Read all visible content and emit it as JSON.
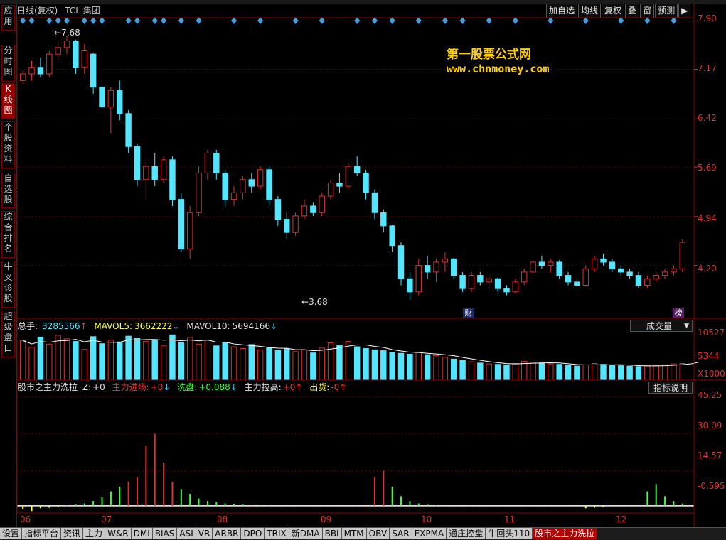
{
  "sidebar": {
    "tabs": [
      {
        "label": "应用",
        "active": false
      },
      {
        "label": "分时图",
        "active": false
      },
      {
        "label": "K线图",
        "active": true
      },
      {
        "label": "个股资料",
        "active": false
      },
      {
        "label": "自选股",
        "active": false
      },
      {
        "label": "综合排名",
        "active": false
      },
      {
        "label": "牛叉诊股",
        "active": false
      },
      {
        "label": "超级盘口",
        "active": false
      }
    ]
  },
  "header": {
    "period": "日线(复权)",
    "stock": "TCL 集团"
  },
  "toolbar": {
    "buttons": [
      "加自选",
      "均线",
      "复权",
      "叠",
      "窗",
      "预测",
      "▶"
    ]
  },
  "watermark": {
    "title": "第一股票公式网",
    "url": "www.chnmoney.com"
  },
  "price_axis": [
    "7.90",
    "7.17",
    "6.42",
    "5.69",
    "4.94",
    "4.20"
  ],
  "annotations": {
    "high": "7.68",
    "low": "3.68",
    "mark1": "财",
    "mark2": "榜"
  },
  "volume": {
    "total_label": "总手:",
    "total_value": "3285566",
    "mavol5_label": "MAVOL5:",
    "mavol5_value": "3662222",
    "mavol10_label": "MAVOL10:",
    "mavol10_value": "5694166",
    "selector": "成交量",
    "axis": [
      "10527",
      "5344",
      "X1000"
    ]
  },
  "indicator": {
    "name": "股市之主力洗拉",
    "z_label": "Z:",
    "z_value": "+0",
    "enter_label": "主力进场:",
    "enter_value": "+0",
    "wash_label": "洗盘:",
    "wash_value": "+0.088",
    "pull_label": "主力拉高:",
    "pull_value": "+0",
    "out_label": "出货:",
    "out_value": "-0",
    "help_button": "指标说明",
    "axis": [
      "45.25",
      "30.09",
      "14.57",
      "-0.595"
    ]
  },
  "x_axis": [
    "06",
    "07",
    "08",
    "09",
    "10",
    "11",
    "12"
  ],
  "bottom_tabs": [
    "设置",
    "指标平台",
    "资讯",
    "主力",
    "W&R",
    "DMI",
    "BIAS",
    "ASI",
    "VR",
    "ARBR",
    "DPO",
    "TRIX",
    "新DMA",
    "BBI",
    "MTM",
    "OBV",
    "SAR",
    "EXPMA",
    "通庄控盘",
    "牛回头110",
    "股市之主力洗拉"
  ],
  "chart_data": {
    "type": "candlestick",
    "ylim": [
      3.4,
      7.95
    ],
    "x": [
      "06",
      "07",
      "08",
      "09",
      "10",
      "11",
      "12"
    ],
    "series": [
      {
        "values": [
          [
            7.0,
            7.15,
            6.95,
            7.1
          ],
          [
            7.1,
            7.3,
            7.0,
            7.2
          ],
          [
            7.2,
            7.35,
            7.05,
            7.1
          ],
          [
            7.1,
            7.45,
            7.05,
            7.4
          ],
          [
            7.4,
            7.6,
            7.3,
            7.5
          ],
          [
            7.5,
            7.68,
            7.4,
            7.6
          ],
          [
            7.6,
            7.62,
            7.1,
            7.2
          ],
          [
            7.2,
            7.55,
            7.1,
            7.45
          ],
          [
            7.4,
            7.42,
            6.8,
            6.9
          ],
          [
            6.9,
            7.0,
            6.5,
            6.6
          ],
          [
            6.6,
            6.9,
            6.2,
            6.85
          ],
          [
            6.85,
            7.0,
            6.4,
            6.5
          ],
          [
            6.5,
            6.55,
            5.9,
            6.0
          ],
          [
            6.0,
            6.05,
            5.4,
            5.5
          ],
          [
            5.5,
            5.8,
            5.2,
            5.7
          ],
          [
            5.7,
            5.9,
            5.4,
            5.5
          ],
          [
            5.5,
            5.85,
            5.45,
            5.8
          ],
          [
            5.8,
            5.85,
            5.1,
            5.2
          ],
          [
            5.2,
            5.3,
            4.4,
            4.45
          ],
          [
            4.45,
            5.1,
            4.3,
            5.0
          ],
          [
            5.0,
            5.7,
            4.95,
            5.6
          ],
          [
            5.6,
            5.95,
            5.5,
            5.9
          ],
          [
            5.9,
            5.95,
            5.5,
            5.6
          ],
          [
            5.6,
            5.65,
            5.1,
            5.2
          ],
          [
            5.2,
            5.4,
            5.1,
            5.3
          ],
          [
            5.3,
            5.55,
            5.2,
            5.5
          ],
          [
            5.5,
            5.6,
            5.3,
            5.4
          ],
          [
            5.4,
            5.7,
            5.35,
            5.65
          ],
          [
            5.65,
            5.7,
            5.1,
            5.2
          ],
          [
            5.2,
            5.25,
            4.8,
            4.9
          ],
          [
            4.9,
            5.0,
            4.6,
            4.7
          ],
          [
            4.7,
            5.0,
            4.65,
            4.95
          ],
          [
            4.95,
            5.2,
            4.9,
            5.1
          ],
          [
            5.1,
            5.15,
            4.95,
            5.0
          ],
          [
            5.0,
            5.3,
            4.95,
            5.25
          ],
          [
            5.25,
            5.5,
            5.2,
            5.45
          ],
          [
            5.45,
            5.6,
            5.3,
            5.4
          ],
          [
            5.4,
            5.75,
            5.35,
            5.7
          ],
          [
            5.7,
            5.85,
            5.55,
            5.6
          ],
          [
            5.6,
            5.65,
            5.2,
            5.3
          ],
          [
            5.3,
            5.35,
            4.9,
            5.0
          ],
          [
            5.0,
            5.05,
            4.7,
            4.8
          ],
          [
            4.8,
            4.82,
            4.4,
            4.5
          ],
          [
            4.5,
            4.55,
            3.9,
            4.0
          ],
          [
            4.0,
            4.1,
            3.68,
            3.8
          ],
          [
            3.8,
            4.3,
            3.75,
            4.2
          ],
          [
            4.2,
            4.35,
            4.0,
            4.1
          ],
          [
            4.1,
            4.3,
            3.95,
            4.25
          ],
          [
            4.25,
            4.4,
            4.1,
            4.3
          ],
          [
            4.3,
            4.32,
            4.0,
            4.05
          ],
          [
            4.05,
            4.1,
            3.8,
            3.85
          ],
          [
            3.85,
            4.1,
            3.8,
            4.05
          ],
          [
            4.05,
            4.1,
            3.9,
            3.95
          ],
          [
            3.95,
            4.05,
            3.85,
            4.0
          ],
          [
            4.0,
            4.02,
            3.8,
            3.85
          ],
          [
            3.85,
            3.9,
            3.75,
            3.8
          ],
          [
            3.8,
            4.0,
            3.78,
            3.95
          ],
          [
            3.95,
            4.15,
            3.9,
            4.1
          ],
          [
            4.1,
            4.3,
            4.05,
            4.25
          ],
          [
            4.25,
            4.35,
            4.15,
            4.2
          ],
          [
            4.2,
            4.3,
            4.1,
            4.25
          ],
          [
            4.25,
            4.28,
            4.0,
            4.05
          ],
          [
            4.05,
            4.1,
            3.9,
            3.95
          ],
          [
            3.95,
            4.0,
            3.85,
            3.9
          ],
          [
            3.9,
            4.2,
            3.88,
            4.15
          ],
          [
            4.15,
            4.35,
            4.1,
            4.3
          ],
          [
            4.3,
            4.38,
            4.2,
            4.25
          ],
          [
            4.25,
            4.3,
            4.1,
            4.15
          ],
          [
            4.15,
            4.2,
            4.05,
            4.1
          ],
          [
            4.1,
            4.15,
            4.0,
            4.05
          ],
          [
            4.05,
            4.1,
            3.85,
            3.9
          ],
          [
            3.9,
            4.05,
            3.85,
            4.0
          ],
          [
            4.0,
            4.1,
            3.95,
            4.05
          ],
          [
            4.05,
            4.15,
            4.0,
            4.1
          ],
          [
            4.1,
            4.2,
            4.05,
            4.15
          ],
          [
            4.15,
            4.6,
            4.1,
            4.55
          ]
        ]
      }
    ]
  },
  "volume_chart": {
    "type": "bar",
    "ylim": [
      0,
      11000
    ],
    "values": [
      9000,
      7500,
      9800,
      8200,
      10200,
      9400,
      8800,
      7000,
      9900,
      8300,
      9100,
      8700,
      10000,
      9600,
      8800,
      9200,
      7900,
      10300,
      8600,
      9700,
      8200,
      9000,
      7800,
      8600,
      7600,
      7200,
      8100,
      6900,
      7400,
      6800,
      7100,
      6500,
      6900,
      6200,
      7300,
      8500,
      7900,
      8800,
      7600,
      7200,
      6900,
      6700,
      6300,
      6100,
      5900,
      6400,
      5800,
      5600,
      5200,
      4800,
      4500,
      4200,
      3900,
      3700,
      3600,
      3500,
      3800,
      4300,
      4100,
      3900,
      3700,
      3600,
      3400,
      3200,
      3500,
      3800,
      3600,
      3400,
      3300,
      3200,
      3100,
      3300,
      3400,
      3500,
      3700,
      3800,
      4200,
      5600
    ],
    "colors": [
      "#e03030",
      "#55e6ff"
    ]
  },
  "indicator_chart": {
    "type": "bar",
    "ylim": [
      -3,
      47
    ],
    "values": [
      -1.5,
      -2.2,
      -1.0,
      -0.8,
      -0.6,
      0.2,
      0.5,
      1.0,
      2.0,
      3.5,
      6.0,
      8.0,
      10.0,
      12.0,
      25.0,
      30.0,
      18.0,
      10.0,
      7.0,
      5.0,
      3.0,
      2.0,
      1.5,
      1.0,
      0.8,
      0.5,
      0.3,
      0.2,
      0.1,
      0.05,
      0.0,
      0.0,
      0.0,
      0.0,
      0.0,
      0.0,
      0.0,
      0.0,
      0.0,
      0.0,
      12.0,
      14.57,
      8.0,
      4.0,
      2.0,
      1.0,
      0.5,
      0.2,
      0.0,
      0.0,
      0.0,
      0.0,
      0.0,
      0.0,
      0.0,
      0.0,
      0.0,
      0.0,
      0.0,
      0.0,
      0.0,
      0.0,
      0.0,
      0.0,
      -1.0,
      -0.8,
      -0.5,
      0.0,
      0.0,
      0.0,
      0.0,
      6.0,
      9.0,
      4.0,
      2.0,
      1.0,
      0.5,
      -2.5
    ]
  }
}
